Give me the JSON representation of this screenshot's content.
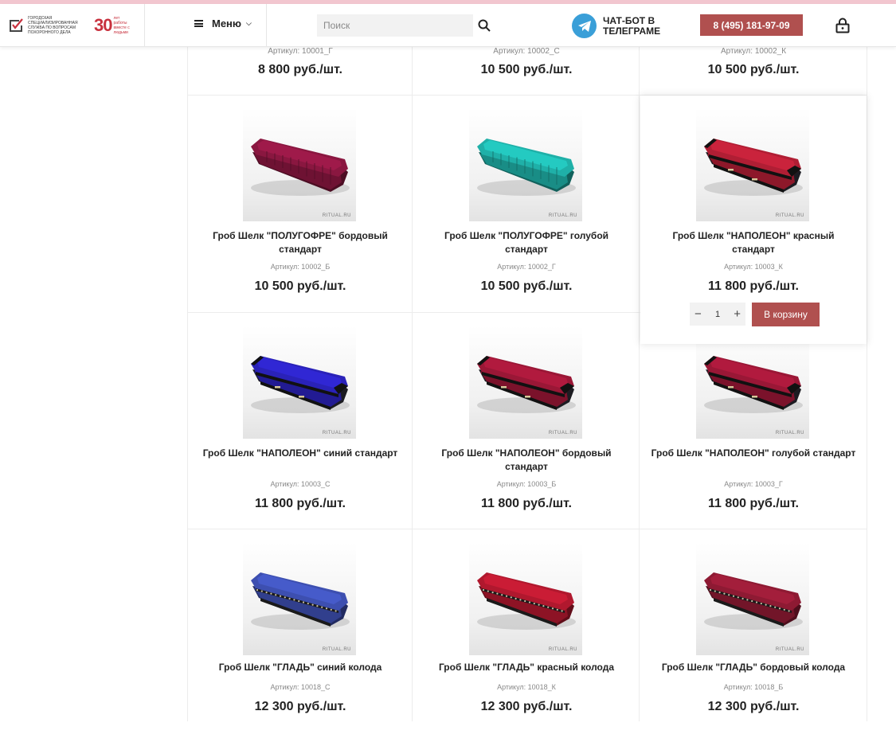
{
  "header": {
    "logo_text": "Городская специализированная служба по вопросам похоронного дела",
    "logo_number": "30",
    "logo_sub": "лет работы вместе с людьми",
    "menu_label": "Меню",
    "search_placeholder": "Поиск",
    "telegram_label": "ЧАТ-БОТ В ТЕЛЕГРАМЕ",
    "phone": "8 (495) 181-97-09"
  },
  "colors": {
    "accent": "#b0504f",
    "telegram": "#3a9fd8",
    "logo_red": "#c8313e"
  },
  "top_row": [
    {
      "article": "Артикул: 10001_Г",
      "price": "8 800 руб./шт."
    },
    {
      "article": "Артикул: 10002_С",
      "price": "10 500 руб./шт."
    },
    {
      "article": "Артикул: 10002_К",
      "price": "10 500 руб./шт."
    }
  ],
  "watermark": "RITUAL.RU",
  "products": [
    {
      "name": "Гроб Шелк \"ПОЛУГОФРЕ\" бордовый стандарт",
      "article": "Артикул: 10002_Б",
      "price": "10 500 руб./шт.",
      "color": "#8a1740",
      "shape": "gofre"
    },
    {
      "name": "Гроб Шелк \"ПОЛУГОФРЕ\" голубой стандарт",
      "article": "Артикул: 10002_Г",
      "price": "10 500 руб./шт.",
      "color": "#1fb0a8",
      "shape": "gofre"
    },
    {
      "name": "Гроб Шелк \"НАПОЛЕОН\" красный стандарт",
      "article": "Артикул: 10003_К",
      "price": "11 800 руб./шт.",
      "color": "#b01e34",
      "shape": "napoleon"
    },
    {
      "name": "Гроб Шелк \"НАПОЛЕОН\" синий стандарт",
      "article": "Артикул: 10003_С",
      "price": "11 800 руб./шт.",
      "color": "#2a22b8",
      "shape": "napoleon"
    },
    {
      "name": "Гроб Шелк \"НАПОЛЕОН\" бордовый стандарт",
      "article": "Артикул: 10003_Б",
      "price": "11 800 руб./шт.",
      "color": "#9a1736",
      "shape": "napoleon"
    },
    {
      "name": "Гроб Шелк \"НАПОЛЕОН\" голубой стандарт",
      "article": "Артикул: 10003_Г",
      "price": "11 800 руб./шт.",
      "color": "#9a1736",
      "shape": "napoleon"
    },
    {
      "name": "Гроб Шелк \"ГЛАДЬ\" синий колода",
      "article": "Артикул: 10018_С",
      "price": "12 300 руб./шт.",
      "color": "#3d4fb0",
      "shape": "glad"
    },
    {
      "name": "Гроб Шелк \"ГЛАДЬ\" красный колода",
      "article": "Артикул: 10018_К",
      "price": "12 300 руб./шт.",
      "color": "#b0182e",
      "shape": "glad"
    },
    {
      "name": "Гроб Шелк \"ГЛАДЬ\" бордовый колода",
      "article": "Артикул: 10018_Б",
      "price": "12 300 руб./шт.",
      "color": "#8e1a33",
      "shape": "glad"
    }
  ],
  "hover_card": {
    "quantity": "1",
    "minus": "−",
    "plus": "+",
    "cart_label": "В корзину"
  }
}
